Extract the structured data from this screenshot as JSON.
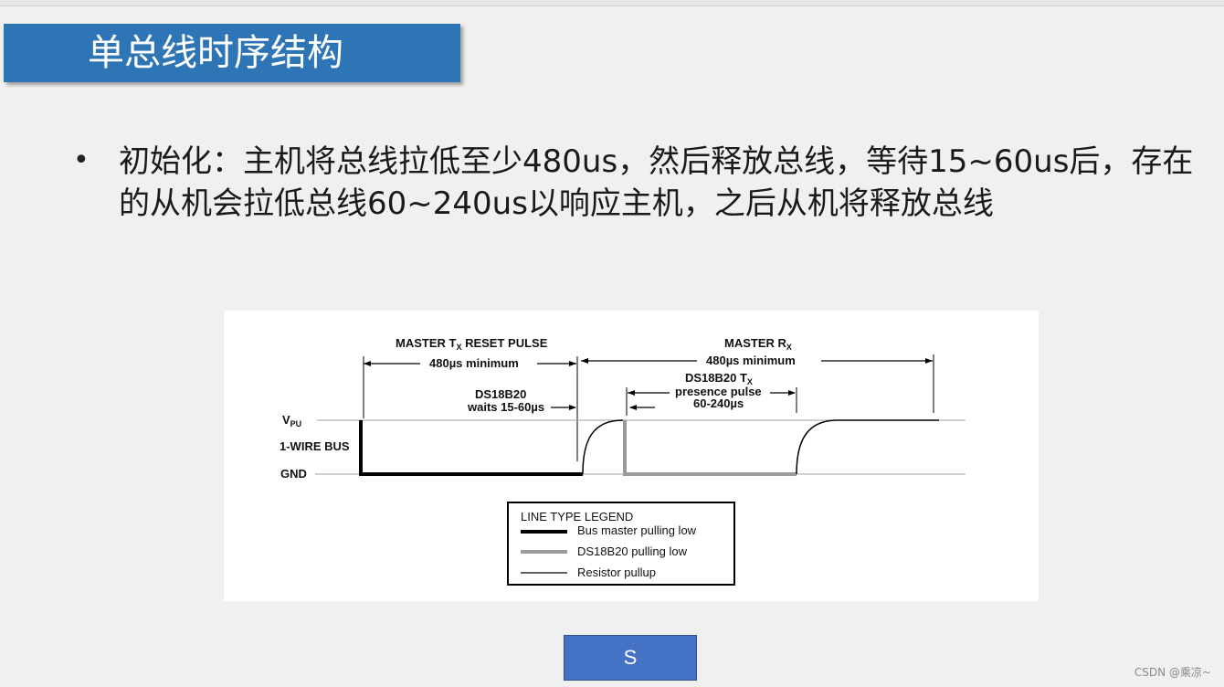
{
  "slide": {
    "title": "单总线时序结构",
    "bullet_text": "初始化：主机将总线拉低至少480us，然后释放总线，等待15~60us后，存在的从机会拉低总线60~240us以响应主机，之后从机将释放总线",
    "button_label": "S",
    "watermark": "CSDN @乘凉~"
  },
  "diagram": {
    "master_tx_label": "MASTER T",
    "master_tx_sub": "X",
    "master_tx_suffix": " RESET PULSE",
    "master_tx_min": "480µs minimum",
    "master_rx_label": "MASTER R",
    "master_rx_sub": "X",
    "master_rx_min": "480µs minimum",
    "ds_wait_line1": "DS18B20",
    "ds_wait_line2": "waits 15-60µs",
    "ds_tx_label": "DS18B20 T",
    "ds_tx_sub": "X",
    "presence_line1": "presence pulse",
    "presence_line2": "60-240µs",
    "vpu_label": "V",
    "vpu_sub": "PU",
    "bus_label": "1-WIRE BUS",
    "gnd_label": "GND",
    "legend": {
      "title": "LINE TYPE LEGEND",
      "items": [
        "Bus master pulling low",
        "DS18B20 pulling low",
        "Resistor pullup"
      ]
    },
    "colors": {
      "master_line": "#000000",
      "slave_line": "#9a9a9a",
      "rail": "#a0a0a0"
    }
  }
}
